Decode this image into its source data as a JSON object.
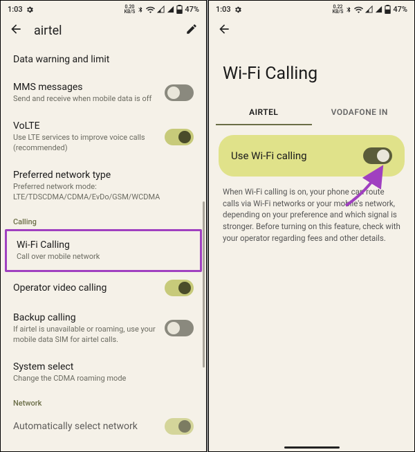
{
  "status": {
    "time": "1:03",
    "speed_top": "0.20",
    "speed_bot": "KB/S",
    "battery_pct": "47%"
  },
  "left": {
    "header_title": "airtel",
    "items": {
      "data_warning": {
        "title": "Data warning and limit"
      },
      "mms": {
        "title": "MMS messages",
        "sub": "Send and receive when mobile data is off"
      },
      "volte": {
        "title": "VoLTE",
        "sub": "Use LTE services to improve voice calls (recommended)"
      },
      "pref_net": {
        "title": "Preferred network type",
        "sub": "Preferred network mode: LTE/TDSCDMA/CDMA/EvDo/GSM/WCDMA"
      },
      "section_calling": "Calling",
      "wifi_calling": {
        "title": "Wi-Fi Calling",
        "sub": "Call over mobile network"
      },
      "op_video": {
        "title": "Operator video calling"
      },
      "backup": {
        "title": "Backup calling",
        "sub": "If airtel is unavailable or roaming, use your mobile data SIM for airtel calls."
      },
      "system_select": {
        "title": "System select",
        "sub": "Change the CDMA roaming mode"
      },
      "section_network": "Network",
      "auto_select": {
        "title": "Automatically select network"
      }
    }
  },
  "right": {
    "page_title": "Wi-Fi Calling",
    "tab1": "AIRTEL",
    "tab2": "VODAFONE IN",
    "banner_label": "Use Wi-Fi calling",
    "description": "When Wi-Fi calling is on, your phone can route calls via Wi-Fi networks or your mobile's network, depending on your preference and which signal is stronger. Before turning on this feature, check with your operator regarding fees and other details."
  },
  "status2": {
    "time": "1:03",
    "speed_top": "0.22",
    "speed_bot": "KB/S",
    "battery_pct": "47%"
  }
}
